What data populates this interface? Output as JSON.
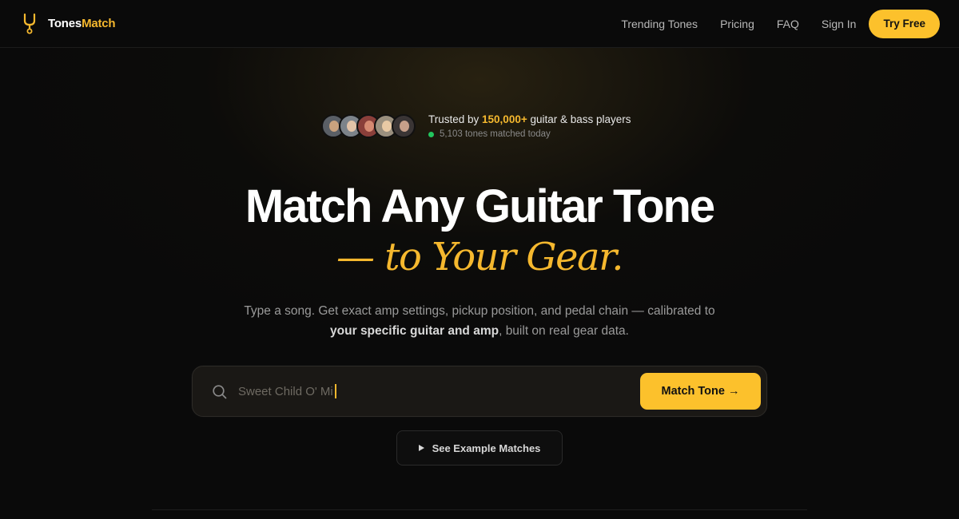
{
  "brand": {
    "name_part1": "Tones",
    "name_part2": "Match",
    "icon": "tuning-fork-icon",
    "accent": "#f5b82e"
  },
  "nav": {
    "links": [
      "Trending Tones",
      "Pricing",
      "FAQ",
      "Sign In"
    ],
    "cta": "Try Free"
  },
  "trust": {
    "prefix": "Trusted by ",
    "highlight": "150,000+",
    "suffix": " guitar & bass players",
    "status": "5,103 tones matched today",
    "status_color": "#22c55e"
  },
  "hero": {
    "title": "Match Any Guitar Tone",
    "title_accent": "— to Your Gear.",
    "subtitle_part1": "Type a song. Get exact amp settings, pickup position, and pedal chain — calibrated to",
    "subtitle_bold": "your specific guitar and amp",
    "subtitle_part2": ", built on real gear data."
  },
  "search": {
    "value": "Sweet Child O' Mi",
    "icon": "search-icon",
    "button": "Match Tone →"
  },
  "examples": {
    "button": "See Example Matches",
    "icon": "play-icon"
  }
}
